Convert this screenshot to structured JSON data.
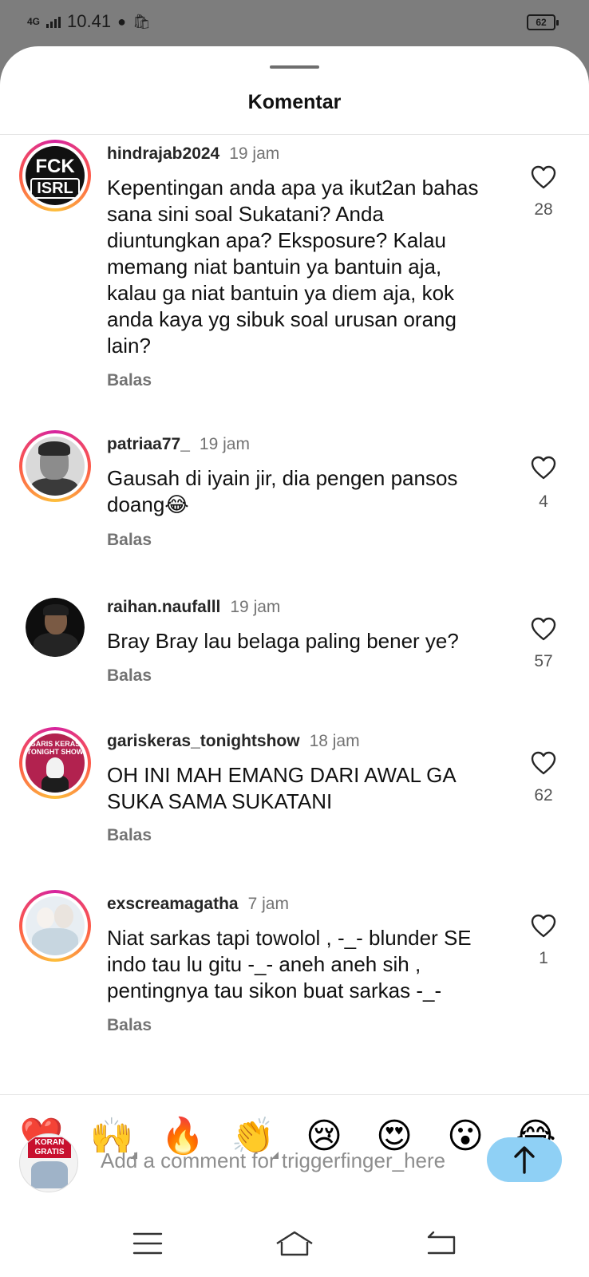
{
  "status_bar": {
    "network": "4G",
    "time": "10.41",
    "battery": "62"
  },
  "sheet": {
    "title": "Komentar"
  },
  "comments": [
    {
      "username": "hindrajab2024",
      "time": "19 jam",
      "text": "Kepentingan anda apa ya ikut2an bahas sana sini soal Sukatani? Anda diuntungkan apa? Eksposure? Kalau memang niat bantuin ya bantuin aja, kalau ga niat bantuin ya diem aja, kok anda kaya yg sibuk soal urusan orang lain?",
      "reply_label": "Balas",
      "likes": "28",
      "avatar_text": [
        "FCK",
        "ISRL"
      ]
    },
    {
      "username": "patriaa77_",
      "time": "19 jam",
      "text": "Gausah di iyain jir, dia pengen pansos doang😂",
      "reply_label": "Balas",
      "likes": "4"
    },
    {
      "username": "raihan.naufalll",
      "time": "19 jam",
      "text": "Bray Bray lau belaga paling bener ye?",
      "reply_label": "Balas",
      "likes": "57"
    },
    {
      "username": "gariskeras_tonightshow",
      "time": "18 jam",
      "text": "OH INI MAH EMANG DARI AWAL GA SUKA SAMA SUKATANI",
      "reply_label": "Balas",
      "likes": "62",
      "avatar_text": [
        "GARIS KERAS",
        "TONIGHT SHOW"
      ]
    },
    {
      "username": "exscreamagatha",
      "time": "7 jam",
      "text": "Niat sarkas tapi towolol , -_- blunder SE indo tau lu gitu -_- aneh aneh sih , pentingnya tau sikon buat sarkas -_-",
      "reply_label": "Balas",
      "likes": "1"
    }
  ],
  "emoji_bar": [
    "❤️",
    "🙌",
    "🔥",
    "👏",
    "😢",
    "😍",
    "😮",
    "😂"
  ],
  "composer": {
    "placeholder": "Add a comment for triggerfinger_here",
    "avatar_badge": [
      "KORAN",
      "GRATIS"
    ]
  },
  "colors": {
    "send_button": "#8fd0f5",
    "story_ring": "#d6249f",
    "status_bar_bg": "#7d7d7d"
  },
  "nav_icons": [
    "menu-icon",
    "home-icon",
    "back-icon"
  ]
}
